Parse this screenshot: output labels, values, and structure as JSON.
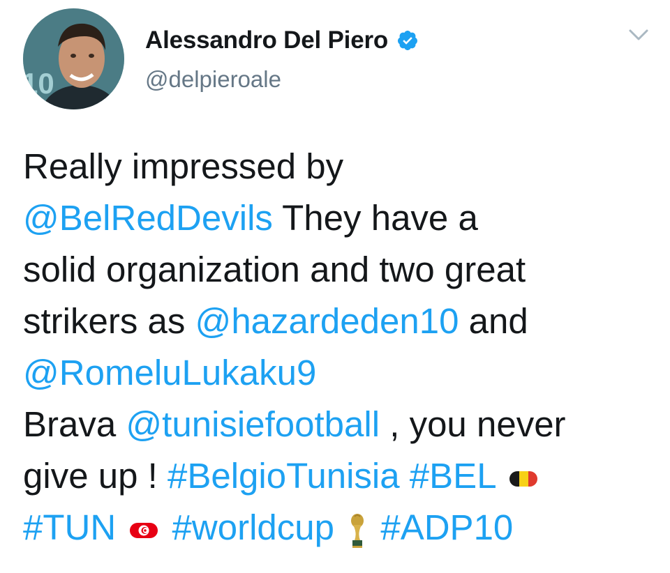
{
  "author": {
    "display_name": "Alessandro Del Piero",
    "handle": "@delpieroale",
    "verified": true,
    "avatar_icon": "profile-photo"
  },
  "tweet": {
    "line1": "Really impressed by",
    "mention_reddevils": "@BelRedDevils",
    "text_they_have": " They have a",
    "line3": "solid organization and two great",
    "text_strikers": "strikers as ",
    "mention_hazard": "@hazardeden10",
    "text_and": " and",
    "mention_lukaku": "@RomeluLukaku9",
    "text_brava": "Brava ",
    "mention_tunisie": "@tunisiefootball",
    "text_never": " , you never",
    "text_giveup": "give up ! ",
    "hashtag_belgiotunisia": "#BelgioTunisia",
    "hashtag_bel": "#BEL",
    "hashtag_tun": "#TUN",
    "hashtag_worldcup": "#worldcup",
    "hashtag_adp10": "#ADP10"
  },
  "icons": {
    "verified": "verified-badge-icon",
    "menu": "chevron-down-icon",
    "belgium": "belgium-flag-icon",
    "tunisia": "tunisia-flag-icon",
    "trophy": "world-cup-trophy-icon"
  },
  "colors": {
    "link": "#1da1f2",
    "text": "#14171a",
    "muted": "#657786"
  }
}
